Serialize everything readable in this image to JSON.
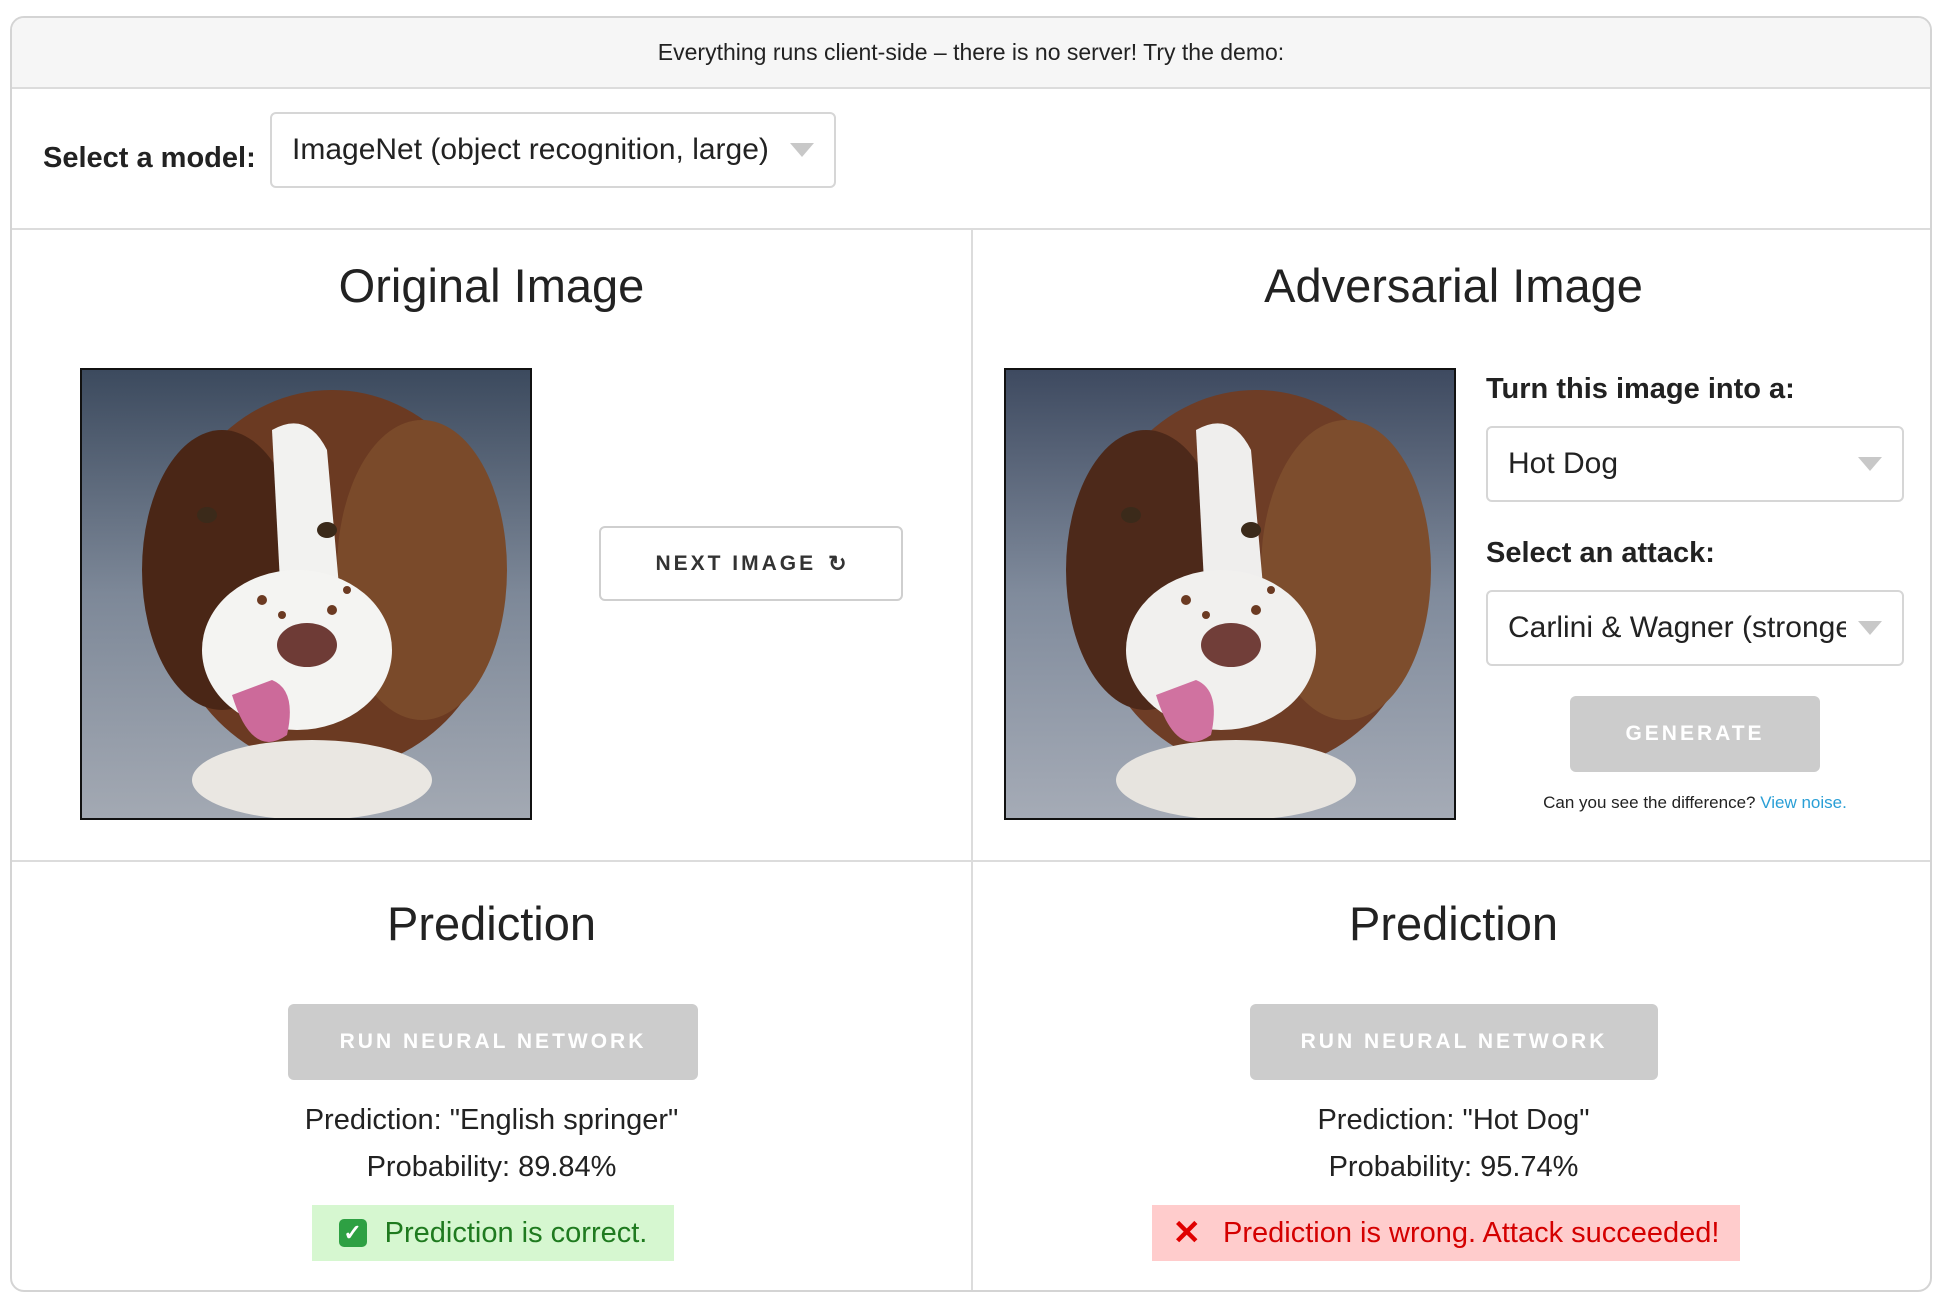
{
  "banner": {
    "text": "Everything runs client-side – there is no server! Try the demo:"
  },
  "model": {
    "label": "Select a model:",
    "selected": "ImageNet (object recognition, large)"
  },
  "original": {
    "title": "Original Image",
    "next_button": "NEXT IMAGE",
    "next_icon": "refresh-icon"
  },
  "adversarial": {
    "title": "Adversarial Image",
    "target_label": "Turn this image into a:",
    "target_selected": "Hot Dog",
    "attack_label": "Select an attack:",
    "attack_selected": "Carlini & Wagner (stronge",
    "generate_button": "GENERATE",
    "difference_text": "Can you see the difference?",
    "view_noise_link": "View noise."
  },
  "prediction_left": {
    "title": "Prediction",
    "run_button": "RUN NEURAL NETWORK",
    "prediction": "Prediction: \"English springer\"",
    "probability": "Probability: 89.84%",
    "status": "Prediction is correct.",
    "status_icon": "check-icon",
    "status_color": "#1f7a1f",
    "status_bg": "#d6f7d0"
  },
  "prediction_right": {
    "title": "Prediction",
    "run_button": "RUN NEURAL NETWORK",
    "prediction": "Prediction: \"Hot Dog\"",
    "probability": "Probability: 95.74%",
    "status": "Prediction is wrong. Attack succeeded!",
    "status_icon": "x-icon",
    "status_color": "#d40000",
    "status_bg": "#ffcccc"
  }
}
